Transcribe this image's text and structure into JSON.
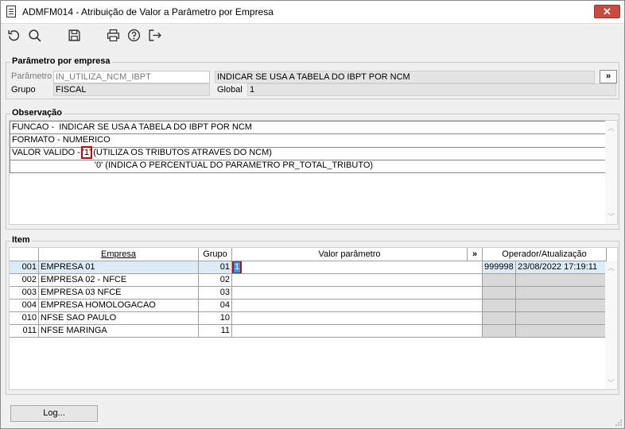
{
  "window": {
    "title": "ADMFM014 - Atribuição de Valor a Parâmetro por Empresa",
    "close_label": "✕"
  },
  "toolbar": {
    "buttons": [
      "refresh-icon",
      "search-icon",
      "save-icon",
      "print-icon",
      "help-icon",
      "exit-icon"
    ]
  },
  "parametro_group": {
    "legend": "Parâmetro por empresa",
    "parametro_label": "Parâmetro",
    "parametro_value": "IN_UTILIZA_NCM_IBPT",
    "descricao_value": "INDICAR SE USA A TABELA DO IBPT POR NCM",
    "more_label": "»",
    "grupo_label": "Grupo",
    "grupo_value": "FISCAL",
    "global_label": "Global",
    "global_value": "1"
  },
  "observacao_group": {
    "legend": "Observação",
    "lines": [
      "FUNCAO -  INDICAR SE USA A TABELA DO IBPT POR NCM",
      "FORMATO - NUMERICO"
    ],
    "valor_valido_prefix": "VALOR VALIDO - ",
    "valor_valido_highlight": "'1'",
    "valor_valido_suffix": " (UTILIZA OS TRIBUTOS ATRAVES DO NCM)",
    "line4": "                                  '0' (INDICA O PERCENTUAL DO PARAMETRO PR_TOTAL_TRIBUTO)"
  },
  "item_group": {
    "legend": "Item",
    "headers": {
      "empresa": "Empresa",
      "grupo": "Grupo",
      "valor": "Valor parâmetro",
      "more": "»",
      "operador": "Operador/Atualização"
    },
    "rows": [
      {
        "code": "001",
        "empresa": "EMPRESA 01",
        "grupo": "01",
        "valor": "1",
        "operador": "999998",
        "atualizacao": "23/08/2022 17:19:11"
      },
      {
        "code": "002",
        "empresa": "EMPRESA 02 - NFCE",
        "grupo": "02",
        "valor": "",
        "operador": "",
        "atualizacao": ""
      },
      {
        "code": "003",
        "empresa": "EMPRESA 03 NFCE",
        "grupo": "03",
        "valor": "",
        "operador": "",
        "atualizacao": ""
      },
      {
        "code": "004",
        "empresa": "EMPRESA HOMOLOGACAO",
        "grupo": "04",
        "valor": "",
        "operador": "",
        "atualizacao": ""
      },
      {
        "code": "010",
        "empresa": "NFSE SAO PAULO",
        "grupo": "10",
        "valor": "",
        "operador": "",
        "atualizacao": ""
      },
      {
        "code": "011",
        "empresa": "NFSE MARINGA",
        "grupo": "11",
        "valor": "",
        "operador": "",
        "atualizacao": ""
      }
    ]
  },
  "footer": {
    "log_label": "Log..."
  }
}
